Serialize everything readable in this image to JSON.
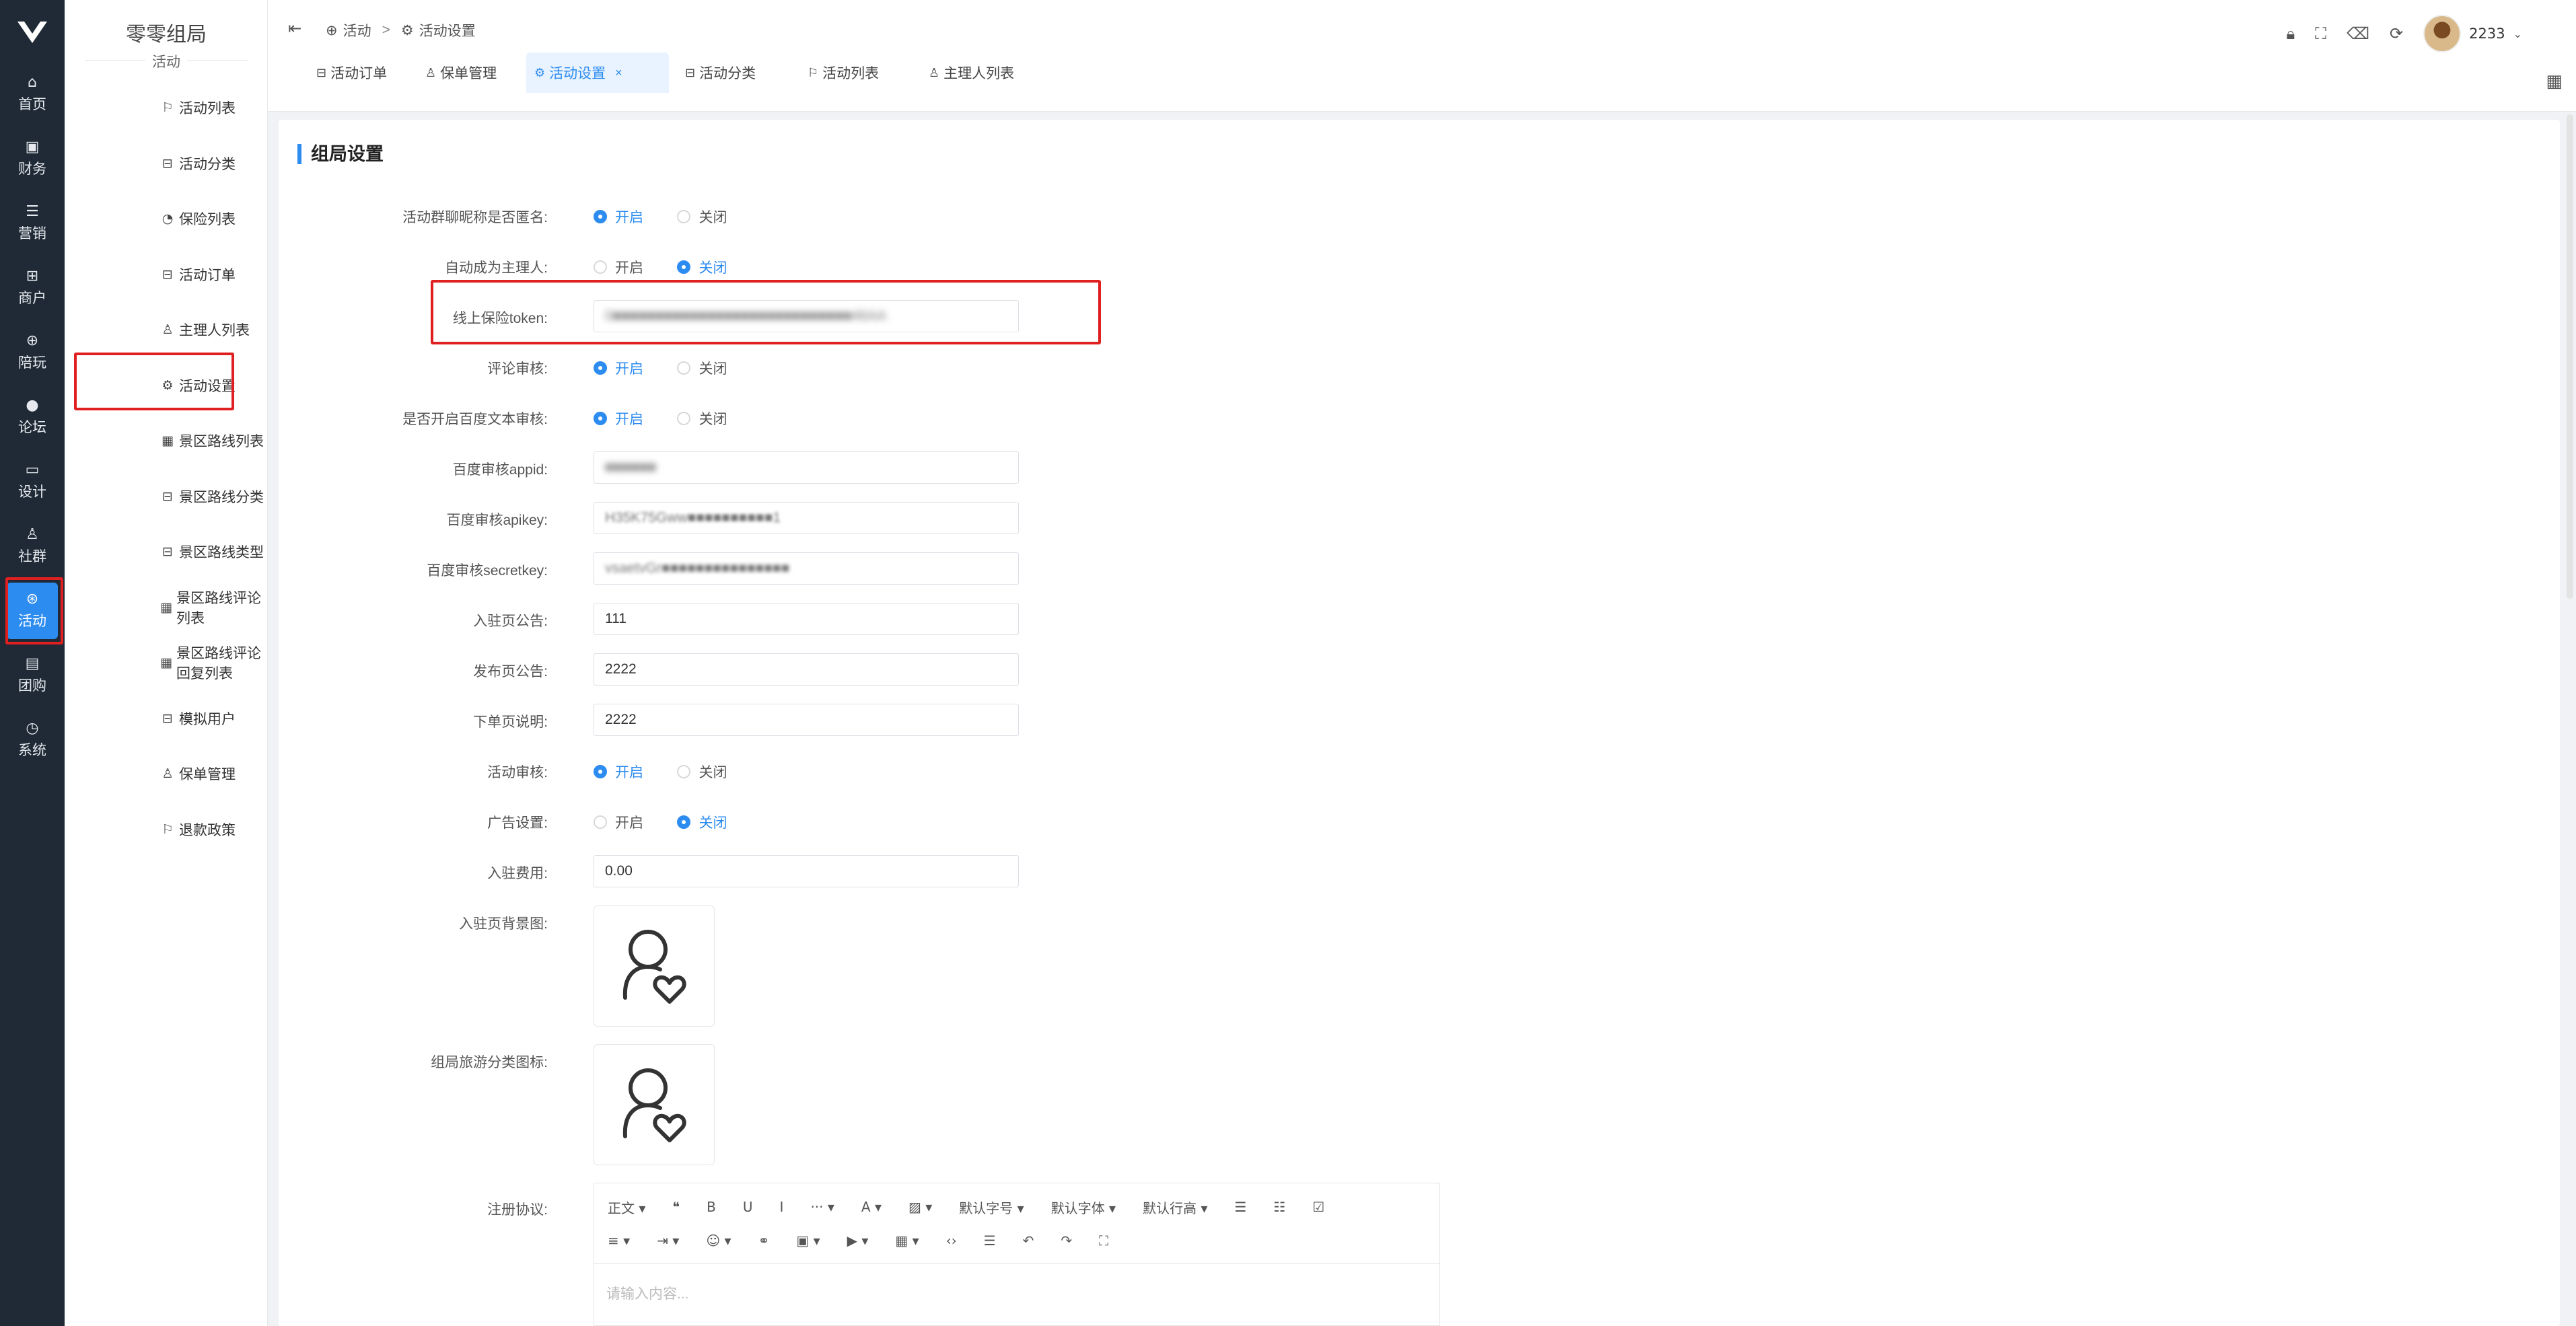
{
  "app": {
    "logo_alt": "V"
  },
  "rail": [
    {
      "label": "首页",
      "icon": "home-icon",
      "glyph": "⌂"
    },
    {
      "label": "财务",
      "icon": "wallet-icon",
      "glyph": "▣"
    },
    {
      "label": "营销",
      "icon": "megaphone-icon",
      "glyph": "☰"
    },
    {
      "label": "商户",
      "icon": "store-icon",
      "glyph": "⊞"
    },
    {
      "label": "陪玩",
      "icon": "game-icon",
      "glyph": "⊕"
    },
    {
      "label": "论坛",
      "icon": "forum-icon",
      "glyph": "●"
    },
    {
      "label": "设计",
      "icon": "design-icon",
      "glyph": "▭"
    },
    {
      "label": "社群",
      "icon": "group-icon",
      "glyph": "♙"
    },
    {
      "label": "活动",
      "icon": "activity-icon",
      "glyph": "⊛"
    },
    {
      "label": "团购",
      "icon": "bag-icon",
      "glyph": "▤"
    },
    {
      "label": "系统",
      "icon": "clock-icon",
      "glyph": "◷"
    }
  ],
  "sidebar": {
    "title": "零零组局",
    "subtitle": "活动",
    "items": [
      {
        "label": "活动列表",
        "glyph": "⚐"
      },
      {
        "label": "活动分类",
        "glyph": "⊟"
      },
      {
        "label": "保险列表",
        "glyph": "◔"
      },
      {
        "label": "活动订单",
        "glyph": "⊟"
      },
      {
        "label": "主理人列表",
        "glyph": "♙"
      },
      {
        "label": "活动设置",
        "glyph": "⚙"
      },
      {
        "label": "景区路线列表",
        "glyph": "▦"
      },
      {
        "label": "景区路线分类",
        "glyph": "⊟"
      },
      {
        "label": "景区路线类型",
        "glyph": "⊟"
      },
      {
        "label": "景区路线评论列表",
        "glyph": "▦"
      },
      {
        "label": "景区路线评论回复列表",
        "glyph": "▦"
      },
      {
        "label": "模拟用户",
        "glyph": "⊟"
      },
      {
        "label": "保单管理",
        "glyph": "♙"
      },
      {
        "label": "退款政策",
        "glyph": "⚐"
      }
    ]
  },
  "header": {
    "breadcrumb_1": "活动",
    "breadcrumb_sep": ">",
    "breadcrumb_2": "活动设置",
    "username": "2233"
  },
  "tabs": [
    {
      "label": "活动订单",
      "glyph": "⊟"
    },
    {
      "label": "保单管理",
      "glyph": "♙"
    },
    {
      "label": "活动设置",
      "glyph": "⚙",
      "close": "×"
    },
    {
      "label": "活动分类",
      "glyph": "⊟"
    },
    {
      "label": "活动列表",
      "glyph": "⚐"
    },
    {
      "label": "主理人列表",
      "glyph": "♙"
    }
  ],
  "form": {
    "title": "组局设置",
    "on": "开启",
    "off": "关闭",
    "fields": {
      "group_anon_label": "活动群聊昵称是否匿名:",
      "auto_host_label": "自动成为主理人:",
      "token_label": "线上保险token:",
      "token_value": "0■■■■■■■■■■■■■■■■■■■■■■■■■■■■46AA",
      "comment_review_label": "评论审核:",
      "baidu_text_label": "是否开启百度文本审核:",
      "appid_label": "百度审核appid:",
      "appid_value": "■■■■■■",
      "apikey_label": "百度审核apikey:",
      "apikey_value": "H35K75Gww■■■■■■■■■■1",
      "secret_label": "百度审核secretkey:",
      "secret_value": "vsaetvGr■■■■■■■■■■■■■■■",
      "join_notice_label": "入驻页公告:",
      "join_notice_value": "111",
      "publish_notice_label": "发布页公告:",
      "publish_notice_value": "2222",
      "order_note_label": "下单页说明:",
      "order_note_value": "2222",
      "activity_review_label": "活动审核:",
      "ad_label": "广告设置:",
      "join_fee_label": "入驻费用:",
      "join_fee_value": "0.00",
      "join_bg_label": "入驻页背景图:",
      "tour_icon_label": "组局旅游分类图标:",
      "agreement_label": "注册协议:",
      "agreement_placeholder": "请输入内容..."
    }
  },
  "editor": {
    "row1": [
      "正文 ▾",
      "❝",
      "B",
      "U",
      "I",
      "··· ▾",
      "A ▾",
      "▨ ▾",
      "默认字号 ▾",
      "默认字体 ▾",
      "默认行高 ▾",
      "☰",
      "☷",
      "☑"
    ],
    "row2": [
      "≡ ▾",
      "⇥ ▾",
      "☺ ▾",
      "⚭",
      "▣ ▾",
      "▶ ▾",
      "▦ ▾",
      "‹›",
      "☰",
      "↶",
      "↷",
      "⛶"
    ]
  }
}
